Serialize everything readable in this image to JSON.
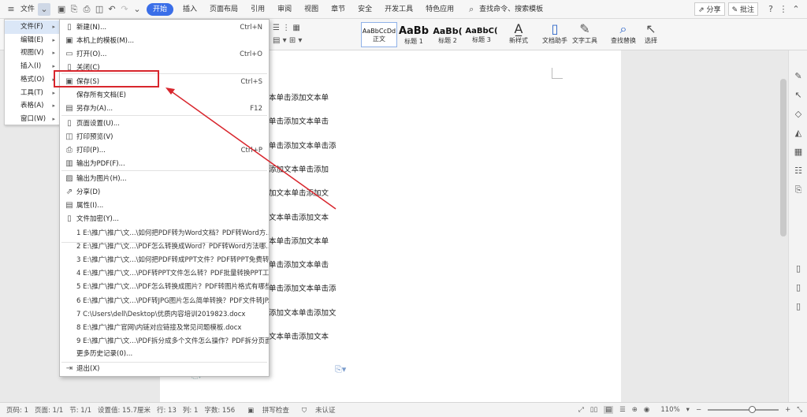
{
  "topbar": {
    "file_label": "文件",
    "tabs": [
      "开始",
      "插入",
      "页面布局",
      "引用",
      "审阅",
      "视图",
      "章节",
      "安全",
      "开发工具",
      "特色应用"
    ],
    "active_tab": "开始",
    "search_label": "查找命令、搜索模板",
    "share_label": "分享",
    "comment_label": "批注"
  },
  "ribbon": {
    "styles": [
      {
        "sample": "AaBbCcDd",
        "name": "正文"
      },
      {
        "sample": "AaBb",
        "name": "标题 1"
      },
      {
        "sample": "AaBb(",
        "name": "标题 2"
      },
      {
        "sample": "AaBbC(",
        "name": "标题 3"
      }
    ],
    "new_style": "新样式",
    "doc_helper": "文档助手",
    "text_tools": "文字工具",
    "find_replace": "查找替换",
    "select": "选择"
  },
  "left_menu": {
    "items": [
      {
        "label": "文件(F)"
      },
      {
        "label": "编辑(E)"
      },
      {
        "label": "视图(V)"
      },
      {
        "label": "插入(I)"
      },
      {
        "label": "格式(O)"
      },
      {
        "label": "工具(T)"
      },
      {
        "label": "表格(A)"
      },
      {
        "label": "窗口(W)"
      }
    ]
  },
  "file_menu": {
    "items": [
      {
        "label": "新建(N)...",
        "shortcut": "Ctrl+N",
        "icon": "new-doc-icon"
      },
      {
        "label": "本机上的模板(M)...",
        "shortcut": "",
        "icon": "template-icon"
      },
      {
        "label": "打开(O)...",
        "shortcut": "Ctrl+O",
        "icon": "folder-icon"
      },
      {
        "label": "关闭(C)",
        "shortcut": "",
        "icon": "close-doc-icon"
      },
      {
        "label": "保存(S)",
        "shortcut": "Ctrl+S",
        "icon": "save-icon"
      },
      {
        "label": "保存所有文档(E)",
        "shortcut": "",
        "icon": ""
      },
      {
        "label": "另存为(A)...",
        "shortcut": "F12",
        "icon": "save-as-icon"
      },
      {
        "label": "页面设置(U)...",
        "shortcut": "",
        "icon": "page-setup-icon"
      },
      {
        "label": "打印预览(V)",
        "shortcut": "",
        "icon": "print-preview-icon"
      },
      {
        "label": "打印(P)...",
        "shortcut": "Ctrl+P",
        "icon": "printer-icon"
      },
      {
        "label": "输出为PDF(F)...",
        "shortcut": "",
        "icon": "pdf-icon"
      },
      {
        "label": "输出为图片(H)...",
        "shortcut": "",
        "icon": "image-icon"
      },
      {
        "label": "分享(D)",
        "shortcut": "",
        "icon": "share-icon"
      },
      {
        "label": "属性(I)...",
        "shortcut": "",
        "icon": "properties-icon"
      },
      {
        "label": "文件加密(Y)...",
        "shortcut": "",
        "icon": "lock-icon"
      }
    ],
    "recent": [
      "1 E:\\推广\\推广\\文...\\如何把PDF转为Word文档？PDF转Word方...",
      "2 E:\\推广\\推广\\文...\\PDF怎么转换成Word？PDF转Word方法哪...",
      "3 E:\\推广\\推广\\文...\\如何把PDF转成PPT文件？PDF转PPT免费转...",
      "4 E:\\推广\\推广\\文...\\PDF转PPT文件怎么转？PDF批量转换PPT工...",
      "5 E:\\推广\\推广\\文...\\PDF怎么转换成图片？PDF转图片格式有哪些...",
      "6 E:\\推广\\推广\\文...\\PDF转JPG图片怎么简单转换？PDF文件转JP...",
      "7 C:\\Users\\dell\\Desktop\\优质内容培训2019823.docx",
      "8 E:\\推广\\推广官网\\内链对应链接及常见问题模板.docx",
      "9 E:\\推广\\推广\\文...\\PDF拆分成多个文件怎么操作？PDF拆分页面..."
    ],
    "more_history": "更多历史记录(0)...",
    "exit": "退出(X)"
  },
  "document": {
    "lines": [
      "本单击添加文本单",
      "单击添加文本单击",
      "单击添加文本单击添",
      "添加文本单击添加",
      "加文本单击添加文",
      "文本单击添加文本",
      "本单击添加文本单",
      "单击添加文本单击",
      "单击添加文本单击添",
      "添加文本单击添加文",
      "文本单击添加文本"
    ]
  },
  "status": {
    "page": "页码: 1",
    "pages": "页面: 1/1",
    "section": "节: 1/1",
    "setting": "设置值: 15.7厘米",
    "row": "行: 13",
    "col": "列: 1",
    "words": "字数: 156",
    "spell": "拼写检查",
    "auth": "未认证",
    "zoom": "110%"
  },
  "colors": {
    "accent": "#3a6ee8",
    "highlight": "#d8262d",
    "arrow": "#d8262d"
  }
}
